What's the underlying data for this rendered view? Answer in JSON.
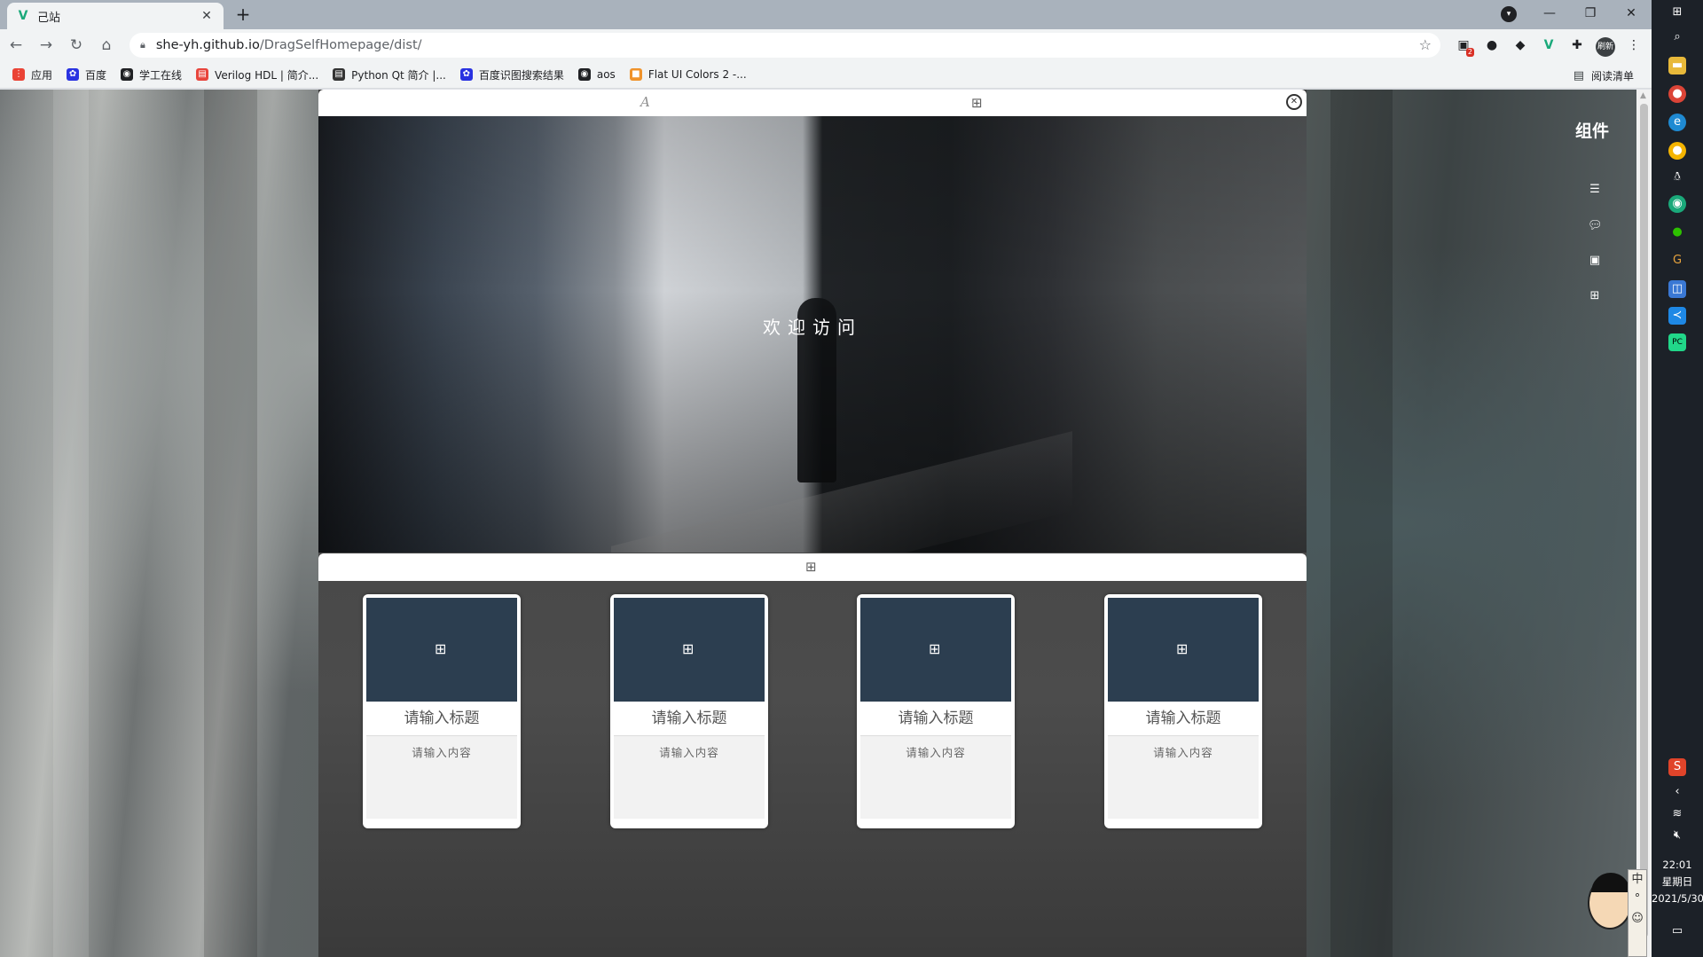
{
  "browser": {
    "tab_title": "己站",
    "url_host": "she-yh.github.io",
    "url_path": "/DragSelfHomepage/dist/",
    "profile_label": "刷新",
    "extension_badge": "2",
    "bookmarks": [
      {
        "label": "应用",
        "icon": "apps-icon",
        "color": "#ea4335"
      },
      {
        "label": "百度",
        "icon": "baidu-icon",
        "color": "#2932e1"
      },
      {
        "label": "学工在线",
        "icon": "globe-icon",
        "color": "#202124"
      },
      {
        "label": "Verilog HDL | 简介...",
        "icon": "doc-icon",
        "color": "#e8453c"
      },
      {
        "label": "Python Qt 简介 |...",
        "icon": "doc-icon",
        "color": "#333333"
      },
      {
        "label": "百度识图搜索结果",
        "icon": "baidu-icon",
        "color": "#2932e1"
      },
      {
        "label": "aos",
        "icon": "globe-icon",
        "color": "#202124"
      },
      {
        "label": "Flat UI Colors 2 -...",
        "icon": "palette-icon",
        "color": "#f0932b"
      }
    ],
    "reading_list": "阅读清单"
  },
  "page": {
    "hero_title": "欢迎访问",
    "cards": [
      {
        "title": "请输入标题",
        "body": "请输入内容"
      },
      {
        "title": "请输入标题",
        "body": "请输入内容"
      },
      {
        "title": "请输入标题",
        "body": "请输入内容"
      },
      {
        "title": "请输入标题",
        "body": "请输入内容"
      }
    ],
    "card_image_color": "#2c3e50"
  },
  "panel": {
    "title": "组件",
    "icons": [
      "list-icon",
      "comment-icon",
      "image-icon",
      "grid-add-icon"
    ]
  },
  "taskbar": {
    "time": "22:01",
    "weekday": "星期日",
    "date": "2021/5/30",
    "ime_label": "中"
  }
}
